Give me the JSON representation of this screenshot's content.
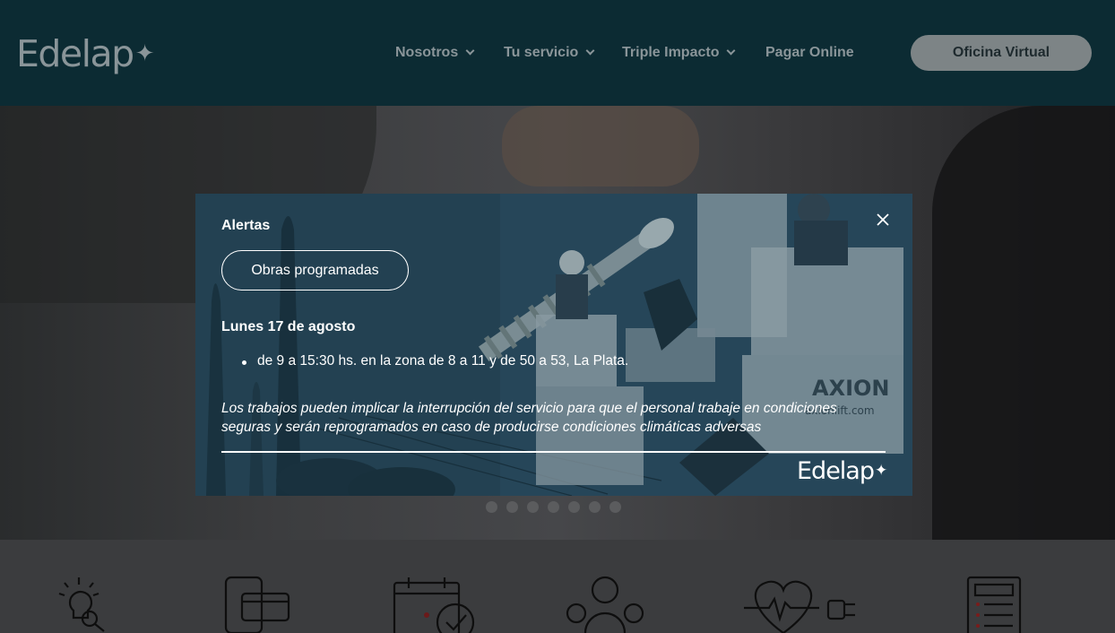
{
  "header": {
    "logo_text": "Edelap",
    "logo_mark": "✦",
    "nav": [
      {
        "label": "Nosotros",
        "has_dropdown": true
      },
      {
        "label": "Tu servicio",
        "has_dropdown": true
      },
      {
        "label": "Triple Impacto",
        "has_dropdown": true
      },
      {
        "label": "Pagar Online",
        "has_dropdown": false
      }
    ],
    "cta_label": "Oficina Virtual"
  },
  "hero": {
    "slide_count": 7
  },
  "features": {
    "icons": [
      "lightbulb-search-icon",
      "phone-card-icon",
      "calendar-check-icon",
      "users-group-icon",
      "heart-plug-icon",
      "invoice-document-icon"
    ]
  },
  "modal": {
    "title": "Alertas",
    "tag_button": "Obras programadas",
    "date": "Lunes 17 de agosto",
    "items": [
      "de 9 a 15:30 hs. en la zona de 8 a 11 y de 50 a 53, La Plata."
    ],
    "note_line1": "Los trabajos pueden implicar la interrupción del servicio para que el personal trabaje en condiciones",
    "note_line2": "seguras y serán reprogramados en caso de producirse condiciones climáticas adversas",
    "footer_logo": "Edelap",
    "footer_mark": "✦",
    "photo_text": {
      "axion": "AXION",
      "axion_web": "axionlift.com"
    }
  },
  "colors": {
    "header_bg": "#0c2b33",
    "nav_text": "#8a9599",
    "cta_bg": "#7d8486",
    "modal_bg": "#2a4150",
    "overlay": "#1c2224"
  }
}
